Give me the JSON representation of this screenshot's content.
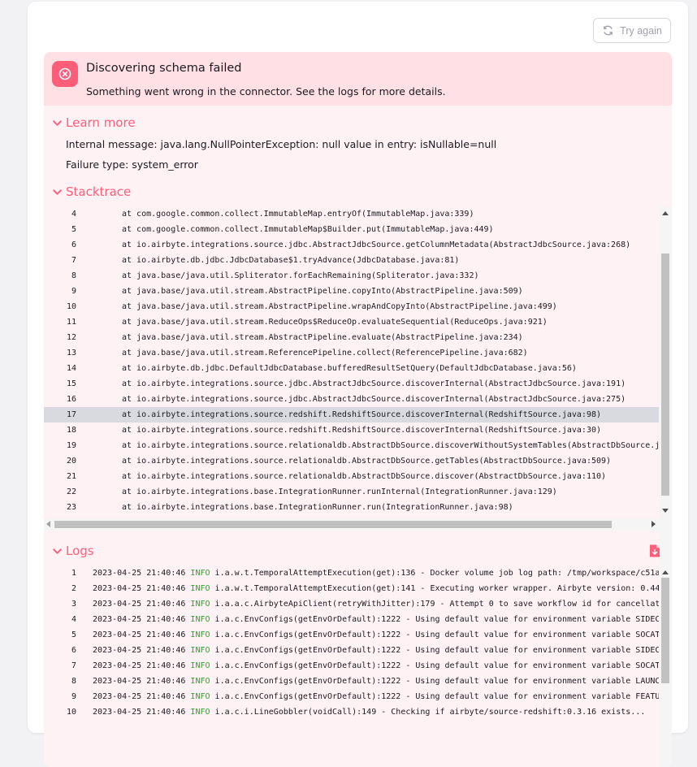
{
  "actions": {
    "try_again_label": "Try again"
  },
  "error": {
    "title": "Discovering schema failed",
    "subtitle": "Something went wrong in the connector. See the logs for more details."
  },
  "learn_more": {
    "title": "Learn more",
    "internal_message": "Internal message: java.lang.NullPointerException: null value in entry: isNullable=null",
    "failure_type": "Failure type: system_error"
  },
  "stacktrace": {
    "title": "Stacktrace",
    "highlighted_line": "17",
    "lines": [
      {
        "n": "4",
        "t": "at com.google.common.collect.ImmutableMap.entryOf(ImmutableMap.java:339)"
      },
      {
        "n": "5",
        "t": "at com.google.common.collect.ImmutableMap$Builder.put(ImmutableMap.java:449)"
      },
      {
        "n": "6",
        "t": "at io.airbyte.integrations.source.jdbc.AbstractJdbcSource.getColumnMetadata(AbstractJdbcSource.java:268)"
      },
      {
        "n": "7",
        "t": "at io.airbyte.db.jdbc.JdbcDatabase$1.tryAdvance(JdbcDatabase.java:81)"
      },
      {
        "n": "8",
        "t": "at java.base/java.util.Spliterator.forEachRemaining(Spliterator.java:332)"
      },
      {
        "n": "9",
        "t": "at java.base/java.util.stream.AbstractPipeline.copyInto(AbstractPipeline.java:509)"
      },
      {
        "n": "10",
        "t": "at java.base/java.util.stream.AbstractPipeline.wrapAndCopyInto(AbstractPipeline.java:499)"
      },
      {
        "n": "11",
        "t": "at java.base/java.util.stream.ReduceOps$ReduceOp.evaluateSequential(ReduceOps.java:921)"
      },
      {
        "n": "12",
        "t": "at java.base/java.util.stream.AbstractPipeline.evaluate(AbstractPipeline.java:234)"
      },
      {
        "n": "13",
        "t": "at java.base/java.util.stream.ReferencePipeline.collect(ReferencePipeline.java:682)"
      },
      {
        "n": "14",
        "t": "at io.airbyte.db.jdbc.DefaultJdbcDatabase.bufferedResultSetQuery(DefaultJdbcDatabase.java:56)"
      },
      {
        "n": "15",
        "t": "at io.airbyte.integrations.source.jdbc.AbstractJdbcSource.discoverInternal(AbstractJdbcSource.java:191)"
      },
      {
        "n": "16",
        "t": "at io.airbyte.integrations.source.jdbc.AbstractJdbcSource.discoverInternal(AbstractJdbcSource.java:275)"
      },
      {
        "n": "17",
        "t": "at io.airbyte.integrations.source.redshift.RedshiftSource.discoverInternal(RedshiftSource.java:98)"
      },
      {
        "n": "18",
        "t": "at io.airbyte.integrations.source.redshift.RedshiftSource.discoverInternal(RedshiftSource.java:30)"
      },
      {
        "n": "19",
        "t": "at io.airbyte.integrations.source.relationaldb.AbstractDbSource.discoverWithoutSystemTables(AbstractDbSource.j"
      },
      {
        "n": "20",
        "t": "at io.airbyte.integrations.source.relationaldb.AbstractDbSource.getTables(AbstractDbSource.java:509)"
      },
      {
        "n": "21",
        "t": "at io.airbyte.integrations.source.relationaldb.AbstractDbSource.discover(AbstractDbSource.java:110)"
      },
      {
        "n": "22",
        "t": "at io.airbyte.integrations.base.IntegrationRunner.runInternal(IntegrationRunner.java:129)"
      },
      {
        "n": "23",
        "t": "at io.airbyte.integrations.base.IntegrationRunner.run(IntegrationRunner.java:98)"
      }
    ]
  },
  "logs": {
    "title": "Logs",
    "lines": [
      {
        "n": "1",
        "ts": "2023-04-25 21:40:46",
        "lvl": "INFO",
        "t": "i.a.w.t.TemporalAttemptExecution(get):136 - Docker volume job log path: /tmp/workspace/c51a"
      },
      {
        "n": "2",
        "ts": "2023-04-25 21:40:46",
        "lvl": "INFO",
        "t": "i.a.w.t.TemporalAttemptExecution(get):141 - Executing worker wrapper. Airbyte version: 0.44"
      },
      {
        "n": "3",
        "ts": "2023-04-25 21:40:46",
        "lvl": "INFO",
        "t": "i.a.a.c.AirbyteApiClient(retryWithJitter):179 - Attempt 0 to save workflow id for cancellat"
      },
      {
        "n": "4",
        "ts": "2023-04-25 21:40:46",
        "lvl": "INFO",
        "t": "i.a.c.EnvConfigs(getEnvOrDefault):1222 - Using default value for environment variable SIDEC"
      },
      {
        "n": "5",
        "ts": "2023-04-25 21:40:46",
        "lvl": "INFO",
        "t": "i.a.c.EnvConfigs(getEnvOrDefault):1222 - Using default value for environment variable SOCAT"
      },
      {
        "n": "6",
        "ts": "2023-04-25 21:40:46",
        "lvl": "INFO",
        "t": "i.a.c.EnvConfigs(getEnvOrDefault):1222 - Using default value for environment variable SIDEC"
      },
      {
        "n": "7",
        "ts": "2023-04-25 21:40:46",
        "lvl": "INFO",
        "t": "i.a.c.EnvConfigs(getEnvOrDefault):1222 - Using default value for environment variable SOCAT"
      },
      {
        "n": "8",
        "ts": "2023-04-25 21:40:46",
        "lvl": "INFO",
        "t": "i.a.c.EnvConfigs(getEnvOrDefault):1222 - Using default value for environment variable LAUNC"
      },
      {
        "n": "9",
        "ts": "2023-04-25 21:40:46",
        "lvl": "INFO",
        "t": "i.a.c.EnvConfigs(getEnvOrDefault):1222 - Using default value for environment variable FEATU"
      },
      {
        "n": "10",
        "ts": "2023-04-25 21:40:46",
        "lvl": "INFO",
        "t": "i.a.c.i.LineGobbler(voidCall):149 - Checking if airbyte/source-redshift:0.3.16 exists..."
      }
    ]
  },
  "icons": {
    "retry": "refresh-icon",
    "error": "close-circle-icon",
    "collapse": "chevron-down-icon",
    "download": "download-file-icon"
  },
  "colors": {
    "accent": "#ff5e7b",
    "error_bg": "#ffe0e4",
    "panel_bg": "#fff2f4",
    "info_level": "#28a428",
    "highlight_row": "#d9d9e0"
  }
}
